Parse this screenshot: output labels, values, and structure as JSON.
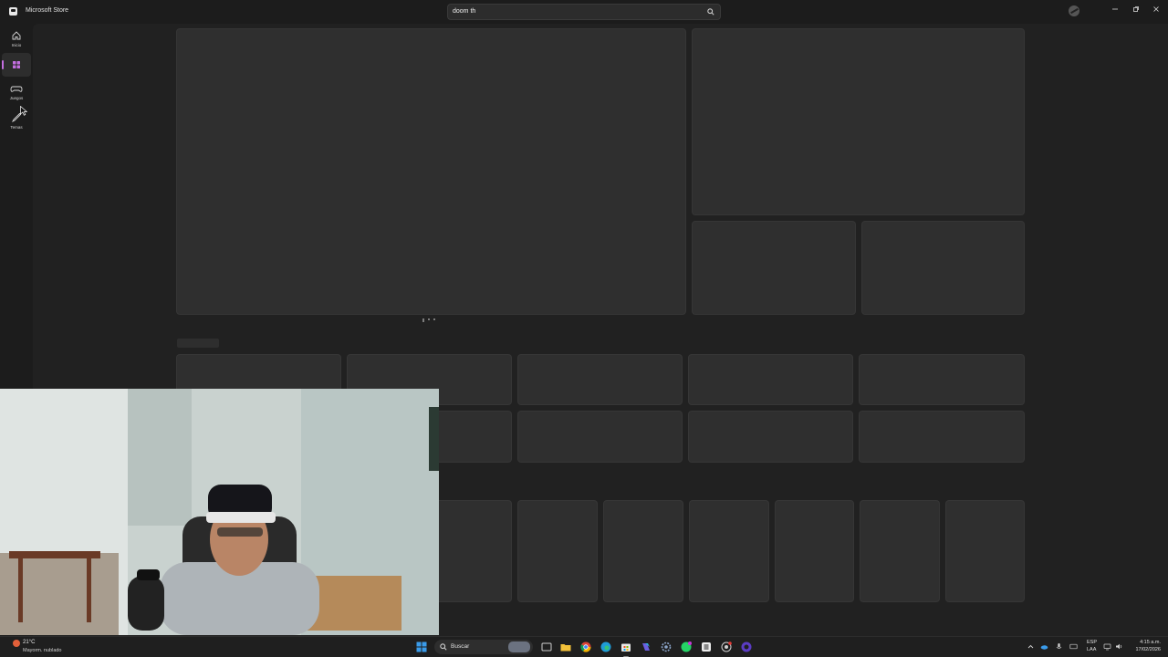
{
  "window": {
    "title": "Microsoft Store",
    "icon": "store-icon"
  },
  "search": {
    "value": "doom th",
    "icon": "search-icon"
  },
  "sidebar": {
    "items": [
      {
        "label": "Inicio",
        "icon": "home-icon"
      },
      {
        "label": "",
        "icon": "apps-icon",
        "selected": true
      },
      {
        "label": "Juegos",
        "icon": "gamepad-icon"
      },
      {
        "label": "Temas",
        "icon": "brush-icon"
      }
    ]
  },
  "content": {
    "state": "loading",
    "carousel_pages": 4
  },
  "taskbar": {
    "weather": {
      "temp": "21°C",
      "desc": "Mayorm. nublado"
    },
    "search_label": "Buscar",
    "language": {
      "top": "ESP",
      "bottom": "LAA"
    },
    "clock": {
      "time": "4:15 a.m.",
      "date": "17/02/2026"
    }
  },
  "colors": {
    "accent": "#c46fe0",
    "background": "#1c1c1c",
    "placeholder": "#2f2f2f"
  }
}
